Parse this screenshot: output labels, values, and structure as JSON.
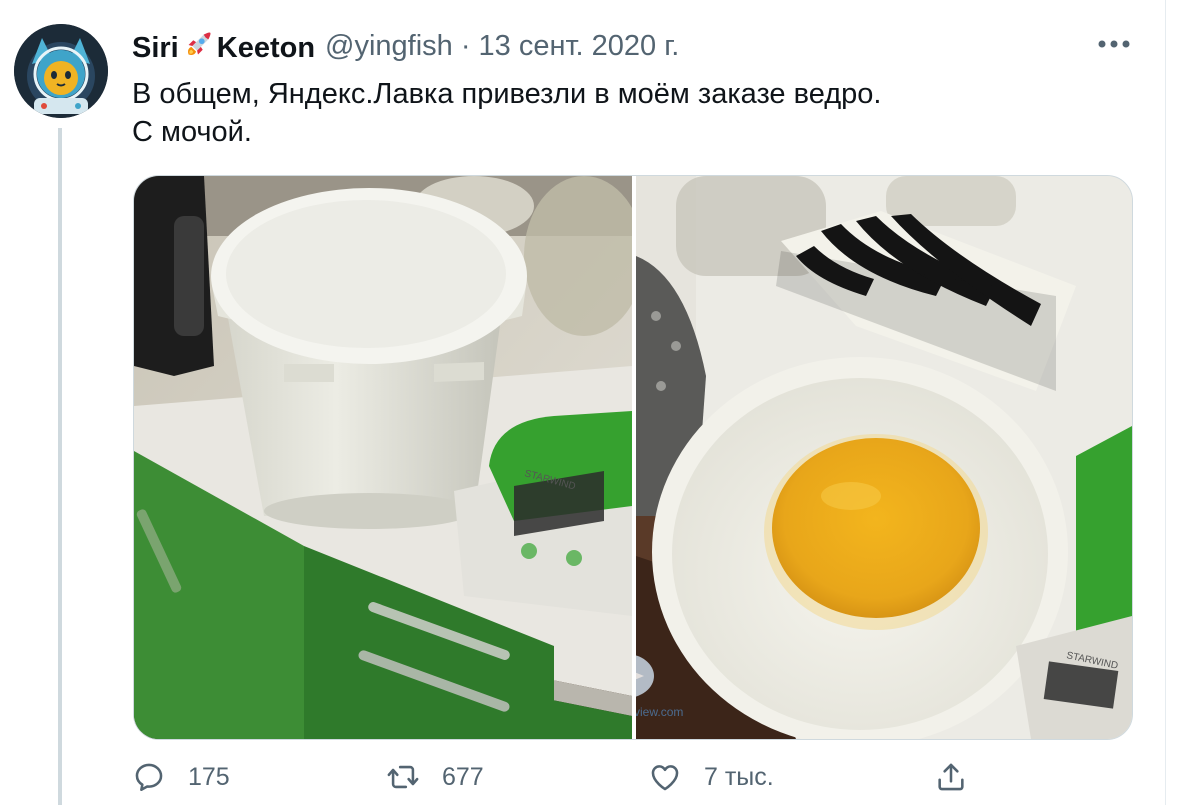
{
  "tweet": {
    "display_name_part1": "Siri",
    "display_name_part2": "Keeton",
    "handle": "@yingfish",
    "separator": "·",
    "date": "13 сент. 2020 г.",
    "text_line1": "В общем, Яндекс.Лавка привезли в моём заказе ведро.",
    "text_line2": "С мочой.",
    "emoji_icon": "rocket-icon"
  },
  "media": {
    "photos": [
      {
        "name": "bucket-photo",
        "scale_brand": "STARWIND"
      },
      {
        "name": "bowl-photo",
        "scale_brand": "STARWIND"
      }
    ],
    "watermark": "mobile-review.com"
  },
  "actions": {
    "reply_count": "175",
    "retweet_count": "677",
    "like_count": "7 тыс.",
    "icons": [
      "reply-icon",
      "retweet-icon",
      "like-icon",
      "share-icon"
    ]
  },
  "colors": {
    "text_primary": "#0f1419",
    "text_secondary": "#536471",
    "divider": "#cfd9de"
  }
}
